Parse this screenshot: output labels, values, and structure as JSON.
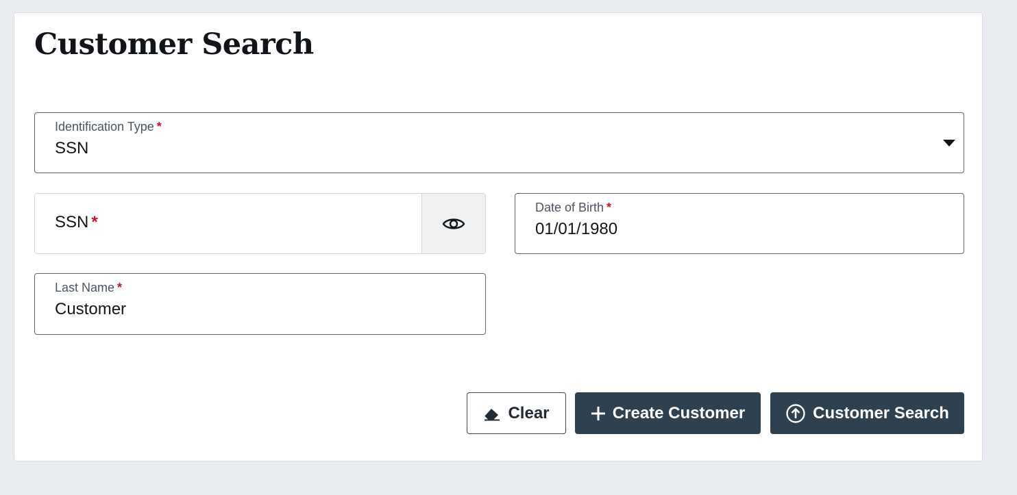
{
  "page": {
    "title": "Customer Search"
  },
  "form": {
    "identification_type": {
      "label": "Identification Type",
      "required_mark": "*",
      "value": "SSN"
    },
    "ssn": {
      "label": "SSN",
      "required_mark": "*",
      "value": ""
    },
    "date_of_birth": {
      "label": "Date of Birth",
      "required_mark": "*",
      "value": "01/01/1980"
    },
    "last_name": {
      "label": "Last Name",
      "required_mark": "*",
      "value": "Customer"
    }
  },
  "actions": {
    "clear_label": "Clear",
    "create_label": "Create Customer",
    "search_label": "Customer Search"
  },
  "icons": {
    "clear": "eraser-icon",
    "create": "plus-icon",
    "search": "arrow-up-circle-icon",
    "ssn_toggle": "eye-icon",
    "dropdown": "caret-down-icon"
  },
  "colors": {
    "primary_button": "#2d4150",
    "required": "#c0182b",
    "background": "#e9ecf0"
  }
}
